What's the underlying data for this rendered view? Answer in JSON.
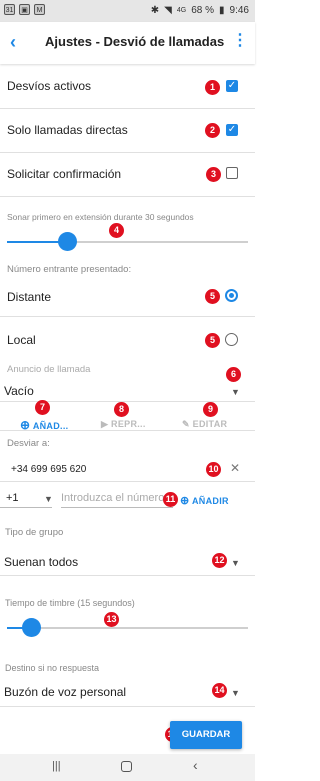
{
  "status_bar": {
    "left_icons": [
      "31",
      "img",
      "mail"
    ],
    "signal": "4G",
    "battery": "68 %",
    "time": "9:46"
  },
  "appbar": {
    "title": "Ajustes - Desvió de llamadas"
  },
  "settings": {
    "active_forwards": {
      "label": "Desvíos activos",
      "checked": true,
      "badge": "1"
    },
    "direct_calls": {
      "label": "Solo llamadas directas",
      "checked": true,
      "badge": "2"
    },
    "request_confirmation": {
      "label": "Solicitar confirmación",
      "checked": false,
      "badge": "3"
    },
    "ring_first": {
      "label": "Sonar primero en extensión durante 30 segundos",
      "value": 0.25,
      "badge": "4"
    },
    "incoming_number": {
      "label": "Número entrante presentado:",
      "options": [
        {
          "label": "Distante",
          "selected": true,
          "badge": "5"
        },
        {
          "label": "Local",
          "selected": false,
          "badge": "5"
        }
      ]
    },
    "announcement": {
      "label": "Anuncio de llamada",
      "value": "Vacío",
      "badge": "6",
      "actions": [
        {
          "label": "AÑAD...",
          "badge": "7",
          "enabled": true
        },
        {
          "label": "REPR...",
          "badge": "8",
          "enabled": false
        },
        {
          "label": "EDITAR",
          "badge": "9",
          "enabled": false
        }
      ]
    },
    "forward_to": {
      "label": "Desviar a:",
      "number": "+34 699 695 620",
      "badge": "10",
      "country_code": "+1",
      "placeholder": "Introduzca el número",
      "badge2": "11",
      "add_label": "AÑADIR"
    },
    "group_type": {
      "label": "Tipo de grupo",
      "value": "Suenan todos",
      "badge": "12"
    },
    "ring_time": {
      "label": "Tiempo de timbre (15 segundos)",
      "value": 0.1,
      "badge": "13"
    },
    "no_answer": {
      "label": "Destino si no respuesta",
      "value": "Buzón de voz personal",
      "badge": "14"
    }
  },
  "save": {
    "label": "GUARDAR",
    "badge": "15"
  },
  "colors": {
    "accent": "#1e88e5",
    "badge": "#e01020"
  }
}
